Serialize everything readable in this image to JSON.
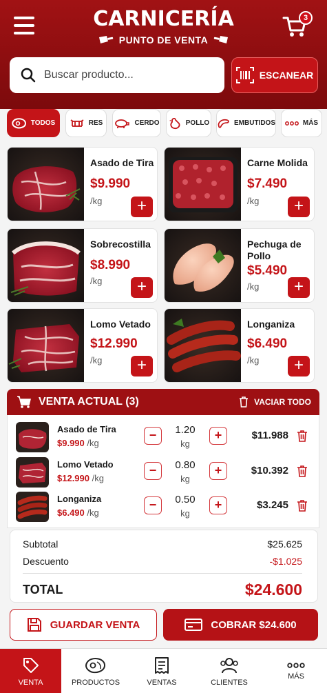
{
  "app": {
    "title": "CARNICERÍA",
    "subtitle": "PUNTO DE VENTA"
  },
  "header": {
    "cart_count": "3"
  },
  "search": {
    "placeholder": "Buscar producto...",
    "scan_label": "ESCANEAR"
  },
  "categories": [
    {
      "label": "TODOS",
      "icon": "steak-icon"
    },
    {
      "label": "RES",
      "icon": "cow-icon"
    },
    {
      "label": "CERDO",
      "icon": "pig-icon"
    },
    {
      "label": "POLLO",
      "icon": "chicken-icon"
    },
    {
      "label": "EMBUTIDOS",
      "icon": "sausage-icon"
    },
    {
      "label": "MÁS",
      "icon": "more-icon"
    }
  ],
  "products": [
    {
      "name": "Asado de Tira",
      "price": "$9.990",
      "unit": "/kg"
    },
    {
      "name": "Carne Molida",
      "price": "$7.490",
      "unit": "/kg"
    },
    {
      "name": "Sobrecostilla",
      "price": "$8.990",
      "unit": "/kg"
    },
    {
      "name": "Pechuga de Pollo",
      "price": "$5.490",
      "unit": "/kg"
    },
    {
      "name": "Lomo Vetado",
      "price": "$12.990",
      "unit": "/kg"
    },
    {
      "name": "Longaniza",
      "price": "$6.490",
      "unit": "/kg"
    }
  ],
  "sale": {
    "title": "VENTA ACTUAL (3)",
    "clear_label": "VACIAR TODO",
    "lines": [
      {
        "name": "Asado de Tira",
        "price": "$9.990",
        "unit": "/kg",
        "qty": "1.20",
        "qty_unit": "kg",
        "total": "$11.988"
      },
      {
        "name": "Lomo Vetado",
        "price": "$12.990",
        "unit": "/kg",
        "qty": "0.80",
        "qty_unit": "kg",
        "total": "$10.392"
      },
      {
        "name": "Longaniza",
        "price": "$6.490",
        "unit": "/kg",
        "qty": "0.50",
        "qty_unit": "kg",
        "total": "$3.245"
      }
    ]
  },
  "totals": {
    "subtotal_label": "Subtotal",
    "subtotal": "$25.625",
    "discount_label": "Descuento",
    "discount": "-$1.025",
    "total_label": "TOTAL",
    "total": "$24.600"
  },
  "actions": {
    "save_label": "GUARDAR VENTA",
    "pay_label": "COBRAR $24.600"
  },
  "nav": [
    {
      "label": "VENTA",
      "icon": "tag-icon"
    },
    {
      "label": "PRODUCTOS",
      "icon": "meat-icon"
    },
    {
      "label": "VENTAS",
      "icon": "receipt-icon"
    },
    {
      "label": "CLIENTES",
      "icon": "users-icon"
    },
    {
      "label": "MÁS",
      "icon": "more-icon"
    }
  ],
  "colors": {
    "primary": "#c41418",
    "header": "#8e0e10",
    "accent_text": "#c41418"
  }
}
